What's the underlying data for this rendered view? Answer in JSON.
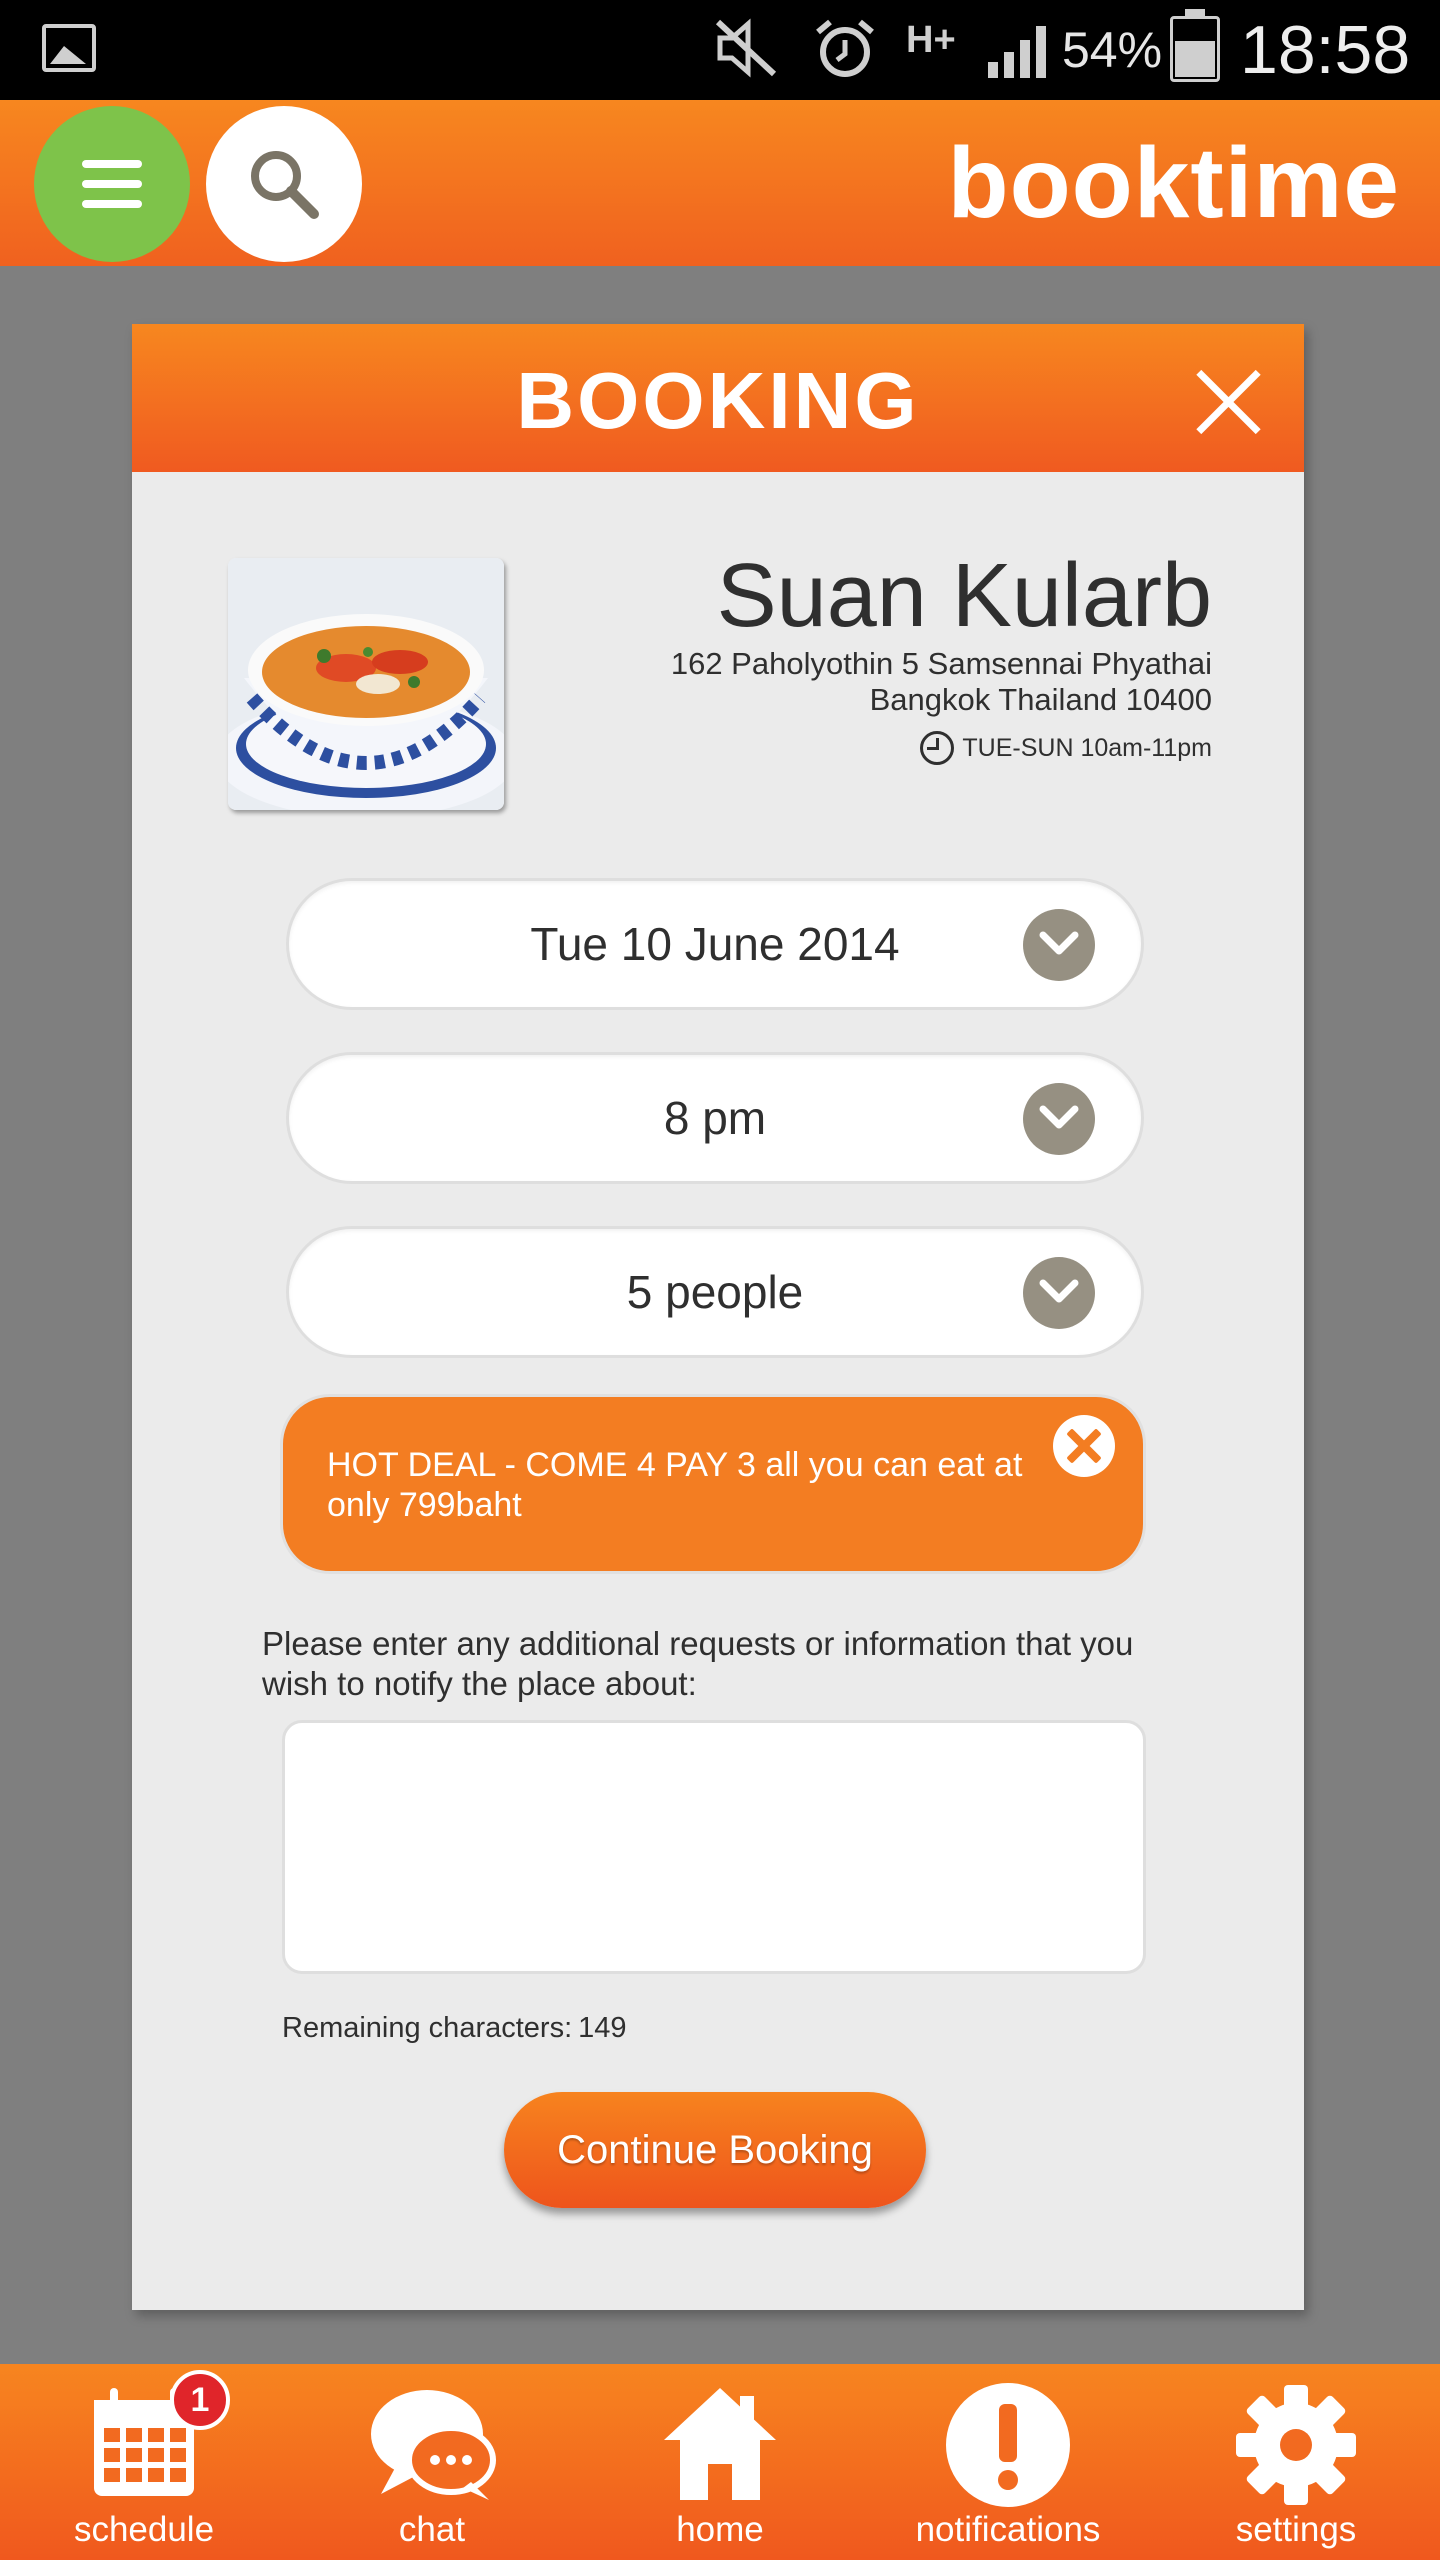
{
  "status_bar": {
    "battery": "54%",
    "time": "18:58",
    "network": "H+"
  },
  "app": {
    "brand": "booktime"
  },
  "modal": {
    "title": "BOOKING"
  },
  "venue": {
    "name": "Suan Kularb",
    "address_line1": "162 Paholyothin 5 Samsennai Phyathai",
    "address_line2": "Bangkok Thailand 10400",
    "hours": "TUE-SUN 10am-11pm"
  },
  "selects": {
    "date": "Tue 10 June 2014",
    "time": "8 pm",
    "people": "5 people"
  },
  "deal": {
    "text": "HOT DEAL - COME 4 PAY 3 all you can eat at only 799baht"
  },
  "request": {
    "label": "Please enter any additional requests or information that you wish to notify the place about:",
    "value": "",
    "remaining_label": "Remaining characters:",
    "remaining_count": "149"
  },
  "continue_label": "Continue Booking",
  "nav": {
    "items": [
      {
        "label": "schedule",
        "icon": "calendar-icon",
        "badge": "1"
      },
      {
        "label": "chat",
        "icon": "chat-icon"
      },
      {
        "label": "home",
        "icon": "home-icon"
      },
      {
        "label": "notifications",
        "icon": "alert-icon"
      },
      {
        "label": "settings",
        "icon": "gear-icon"
      }
    ]
  },
  "colors": {
    "accent": "#f37d22",
    "menu_green": "#7ec34a",
    "chevron_gray": "#969082",
    "badge_red": "#e0252a"
  }
}
